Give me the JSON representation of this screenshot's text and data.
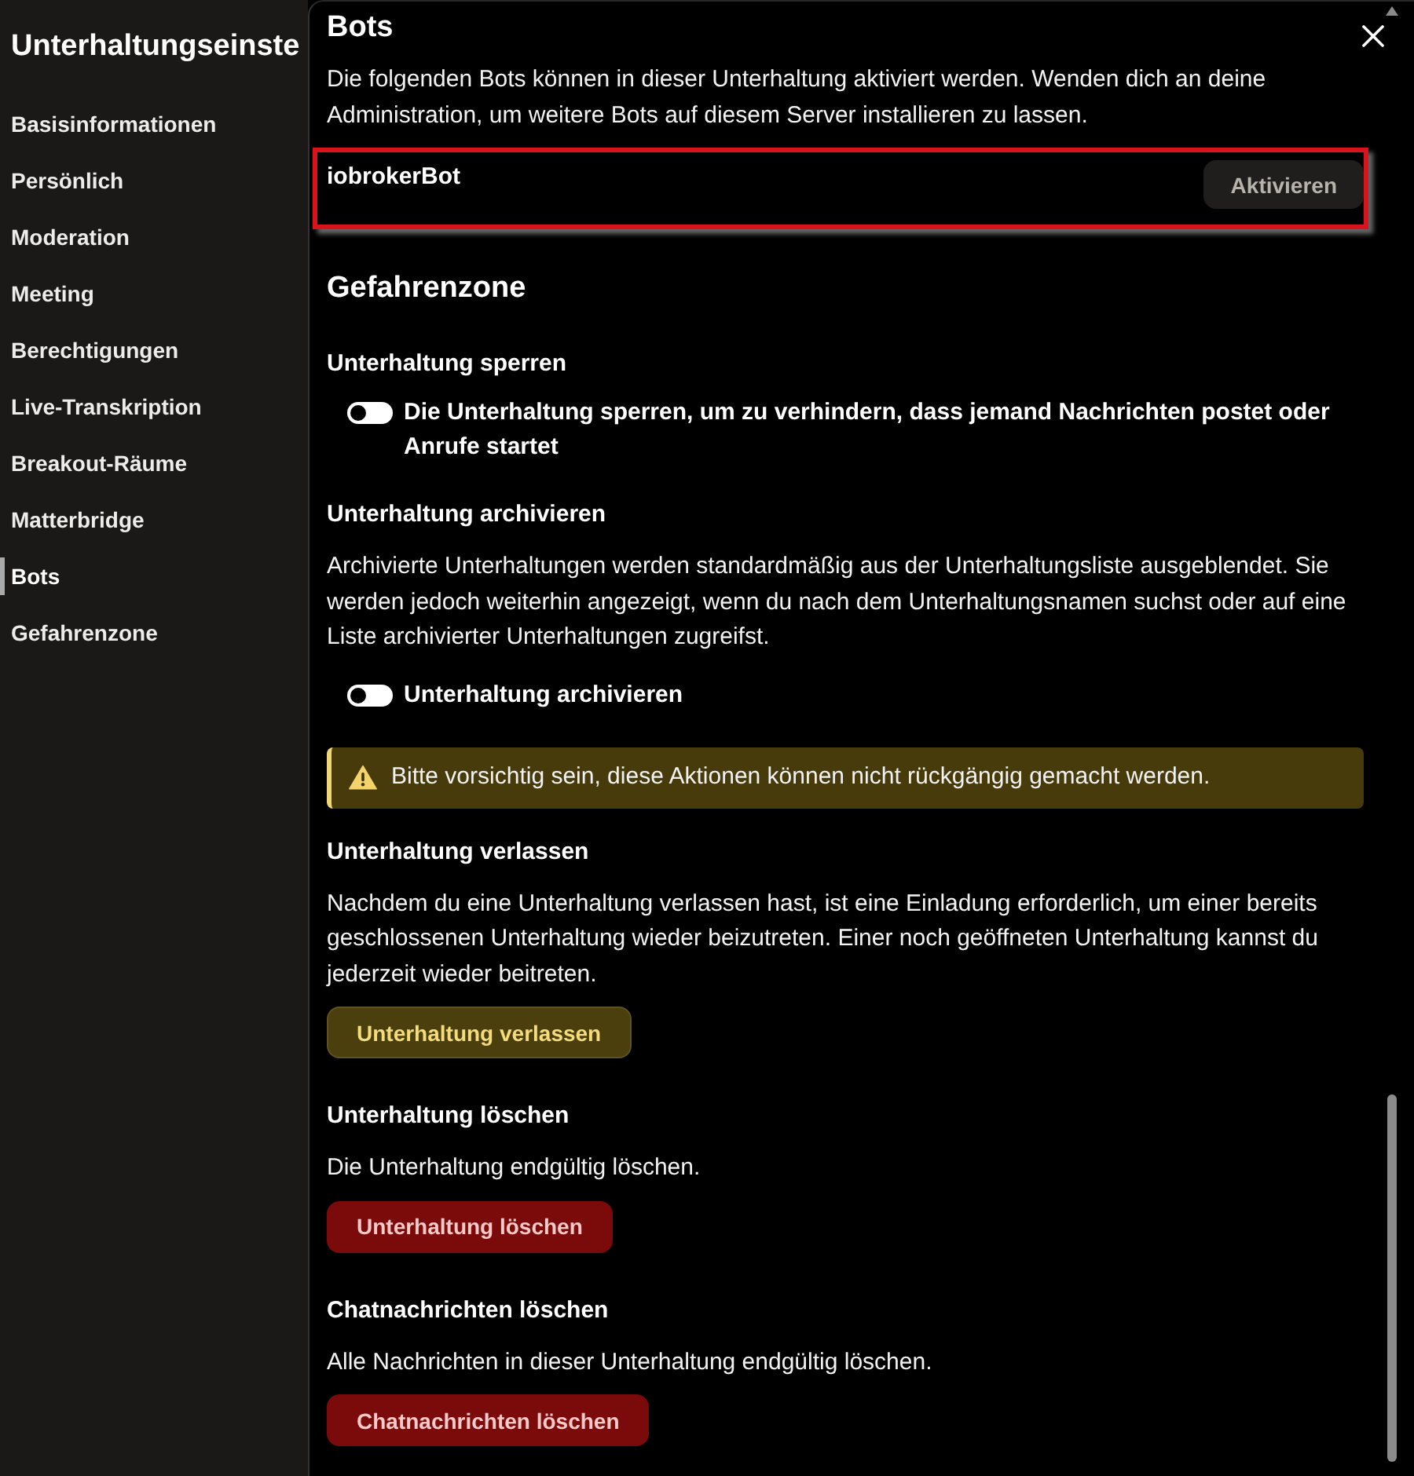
{
  "sidebar": {
    "title": "Unterhaltungseinste",
    "items": [
      {
        "label": "Basisinformationen",
        "selected": false
      },
      {
        "label": "Persönlich",
        "selected": false
      },
      {
        "label": "Moderation",
        "selected": false
      },
      {
        "label": "Meeting",
        "selected": false
      },
      {
        "label": "Berechtigungen",
        "selected": false
      },
      {
        "label": "Live-Transkription",
        "selected": false
      },
      {
        "label": "Breakout-Räume",
        "selected": false
      },
      {
        "label": "Matterbridge",
        "selected": false
      },
      {
        "label": "Bots",
        "selected": true
      },
      {
        "label": "Gefahrenzone",
        "selected": false
      }
    ]
  },
  "bots": {
    "title": "Bots",
    "description": "Die folgenden Bots können in dieser Unterhaltung aktiviert werden. Wenden dich an deine Administration, um weitere Bots auf diesem Server installieren zu lassen.",
    "items": [
      {
        "name": "iobrokerBot",
        "highlighted": true,
        "button": "Aktivieren"
      }
    ]
  },
  "danger_zone": {
    "title": "Gefahrenzone",
    "sections": [
      {
        "kind": "toggle",
        "title": "Unterhaltung sperren",
        "toggle": {
          "label": "Die Unterhaltung sperren, um zu verhindern, dass jemand Nachrichten postet oder Anrufe startet",
          "checked": false
        }
      },
      {
        "kind": "toggle",
        "title": "Unterhaltung archivieren",
        "description": "Archivierte Unterhaltungen werden standardmäßig aus der Unterhaltungsliste ausgeblendet. Sie werden jedoch weiterhin angezeigt, wenn du nach dem Unterhaltungsnamen suchst oder auf eine Liste archivierter Unterhaltungen zugreifst.",
        "toggle": {
          "label": "Unterhaltung archivieren",
          "checked": false
        }
      },
      {
        "kind": "notice",
        "text": "Bitte vorsichtig sein, diese Aktionen können nicht rückgängig gemacht werden."
      },
      {
        "kind": "warning",
        "title": "Unterhaltung verlassen",
        "description": "Nachdem du eine Unterhaltung verlassen hast, ist eine Einladung erforderlich, um einer bereits geschlossenen Unterhaltung wieder beizutreten. Einer noch geöffneten Unterhaltung kannst du jederzeit wieder beitreten.",
        "button": "Unterhaltung verlassen"
      },
      {
        "kind": "danger",
        "title": "Unterhaltung löschen",
        "description": "Die Unterhaltung endgültig löschen.",
        "button": "Unterhaltung löschen"
      },
      {
        "kind": "danger",
        "title": "Chatnachrichten löschen",
        "description": "Alle Nachrichten in dieser Unterhaltung endgültig löschen.",
        "button": "Chatnachrichten löschen"
      }
    ]
  }
}
